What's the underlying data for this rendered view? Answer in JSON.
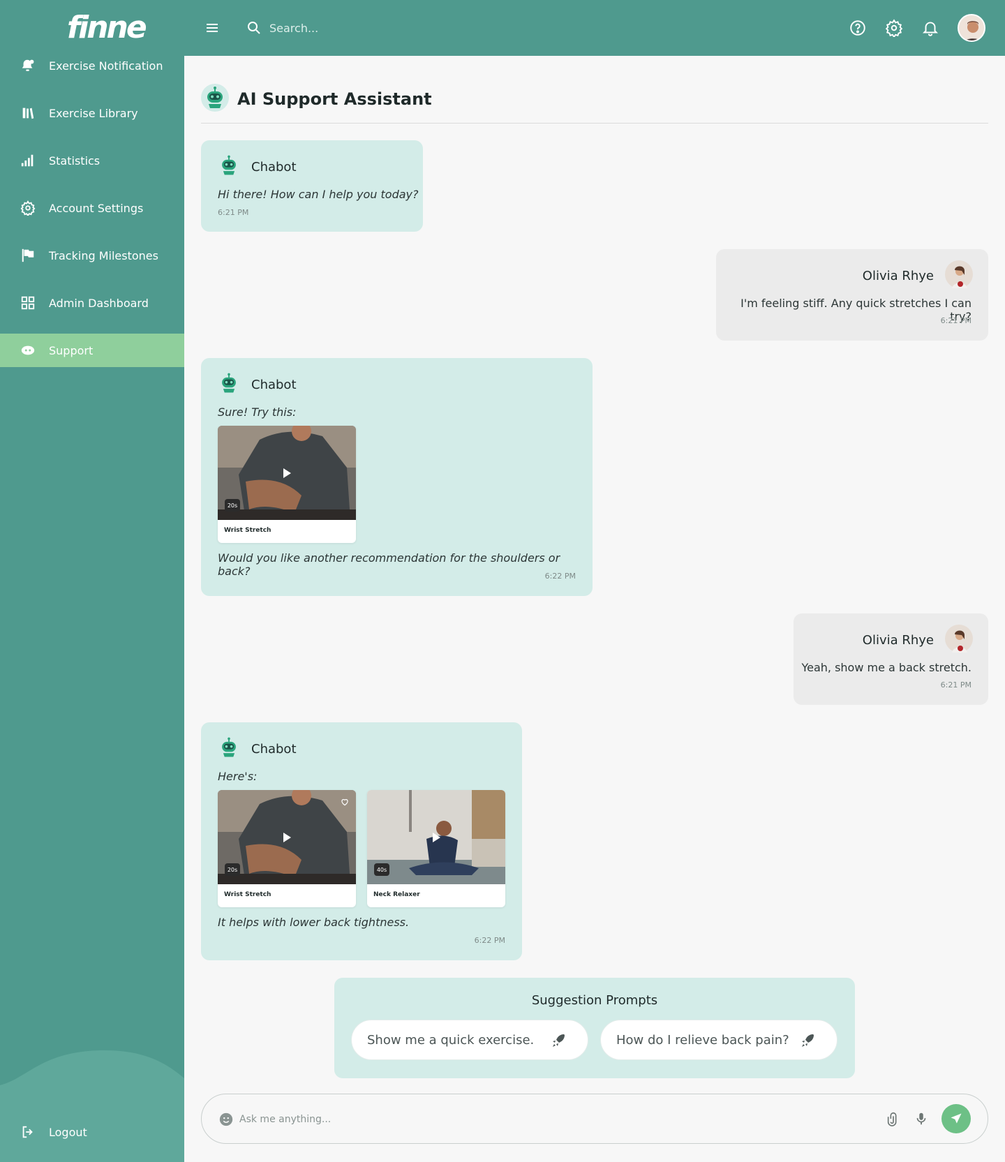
{
  "app": {
    "logo": "finne"
  },
  "sidebar": {
    "items": [
      {
        "label": "Exercise Notification",
        "icon": "bell-person-icon"
      },
      {
        "label": "Exercise Library",
        "icon": "library-icon"
      },
      {
        "label": "Statistics",
        "icon": "bar-chart-icon"
      },
      {
        "label": "Account Settings",
        "icon": "gear-icon"
      },
      {
        "label": "Tracking Milestones",
        "icon": "flag-icon"
      },
      {
        "label": "Admin Dashboard",
        "icon": "grid-icon"
      },
      {
        "label": "Support",
        "icon": "support-icon",
        "active": true
      }
    ],
    "logout": "Logout"
  },
  "header": {
    "search_placeholder": "Search...",
    "icons": [
      "help-icon",
      "gear-icon",
      "bell-icon",
      "avatar"
    ]
  },
  "main": {
    "title": "AI Support Assistant",
    "messages": [
      {
        "from": "bot",
        "name": "Chabot",
        "text": "Hi there! How can I help you today?",
        "time": "6:21 PM"
      },
      {
        "from": "user",
        "name": "Olivia Rhye",
        "text": "I'm feeling stiff. Any quick stretches I can try?",
        "time": "6:21 PM"
      },
      {
        "from": "bot",
        "name": "Chabot",
        "text": "Sure! Try this:",
        "cards": [
          {
            "label": "Wrist Stretch",
            "duration": "20s"
          }
        ],
        "followup": "Would you like another recommendation for the shoulders or back?",
        "time": "6:22 PM"
      },
      {
        "from": "user",
        "name": "Olivia Rhye",
        "text": "Yeah, show me a back stretch.",
        "time": "6:21 PM"
      },
      {
        "from": "bot",
        "name": "Chabot",
        "text": "Here's:",
        "cards": [
          {
            "label": "Wrist Stretch",
            "duration": "20s"
          },
          {
            "label": "Neck Relaxer",
            "duration": "40s"
          }
        ],
        "followup": "It helps with lower back tightness.",
        "time": "6:22 PM"
      }
    ]
  },
  "suggestions": {
    "title": "Suggestion Prompts",
    "items": [
      "Show me a quick exercise.",
      "How do I relieve back pain?"
    ]
  },
  "composer": {
    "placeholder": "Ask me anything..."
  },
  "colors": {
    "brand": "#4f9a8e",
    "active": "#8fcf9c",
    "bot_bubble": "#d3ece8",
    "user_bubble": "#ebebeb",
    "send": "#6dc086"
  }
}
